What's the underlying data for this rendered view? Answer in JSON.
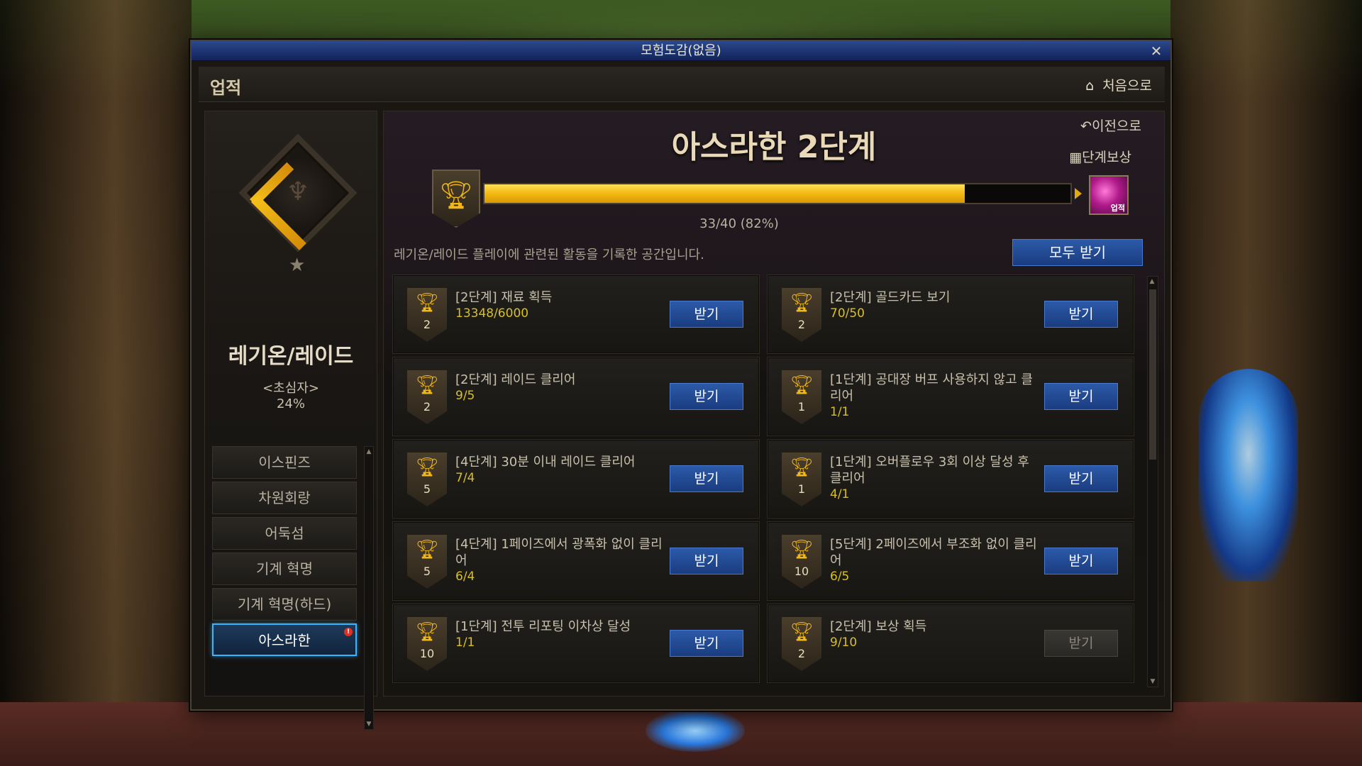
{
  "window": {
    "title": "모험도감(없음)",
    "close_label": "✕"
  },
  "header": {
    "title": "업적",
    "home_label": "처음으로",
    "home_icon": "home-icon"
  },
  "sidebar": {
    "category_name": "레기온/레이드",
    "rank_label": "<초심자>",
    "rank_percent": "24%",
    "menu": [
      {
        "label": "이스핀즈",
        "active": false
      },
      {
        "label": "차원회랑",
        "active": false
      },
      {
        "label": "어둑섬",
        "active": false
      },
      {
        "label": "기계 혁명",
        "active": false
      },
      {
        "label": "기계 혁명(하드)",
        "active": false
      },
      {
        "label": "아스라한",
        "active": true,
        "badge": "!"
      }
    ]
  },
  "content": {
    "back_label": "이전으로",
    "stage_reward_label": "단계보상",
    "stage_title": "아스라한 2단계",
    "progress_text": "33/40 (82%)",
    "progress_fraction": 0.82,
    "reward_tag": "업적",
    "description": "레기온/레이드 플레이에 관련된 활동을 기록한 공간입니다.",
    "claim_all_label": "모두 받기",
    "claim_label": "받기",
    "achievements": [
      {
        "name": "[2단계] 재료 획득",
        "progress": "13348/6000",
        "points": "2",
        "enabled": true
      },
      {
        "name": "[2단계] 골드카드 보기",
        "progress": "70/50",
        "points": "2",
        "enabled": true
      },
      {
        "name": "[2단계] 레이드 클리어",
        "progress": "9/5",
        "points": "2",
        "enabled": true
      },
      {
        "name": "[1단계] 공대장 버프 사용하지 않고 클리어",
        "progress": "1/1",
        "points": "1",
        "enabled": true
      },
      {
        "name": "[4단계] 30분 이내 레이드 클리어",
        "progress": "7/4",
        "points": "5",
        "enabled": true
      },
      {
        "name": "[1단계] 오버플로우 3회 이상 달성 후 클리어",
        "progress": "4/1",
        "points": "1",
        "enabled": true
      },
      {
        "name": "[4단계] 1페이즈에서 광폭화 없이 클리어",
        "progress": "6/4",
        "points": "5",
        "enabled": true
      },
      {
        "name": "[5단계] 2페이즈에서 부조화 없이 클리어",
        "progress": "6/5",
        "points": "10",
        "enabled": true
      },
      {
        "name": "[1단계] 전투 리포팅 이차상 달성",
        "progress": "1/1",
        "points": "10",
        "enabled": true
      },
      {
        "name": "[2단계] 보상 획득",
        "progress": "9/10",
        "points": "2",
        "enabled": false
      }
    ]
  },
  "colors": {
    "accent_gold": "#f3b812",
    "button_blue": "#2c5aa8",
    "active_border": "#3ab4ff"
  }
}
